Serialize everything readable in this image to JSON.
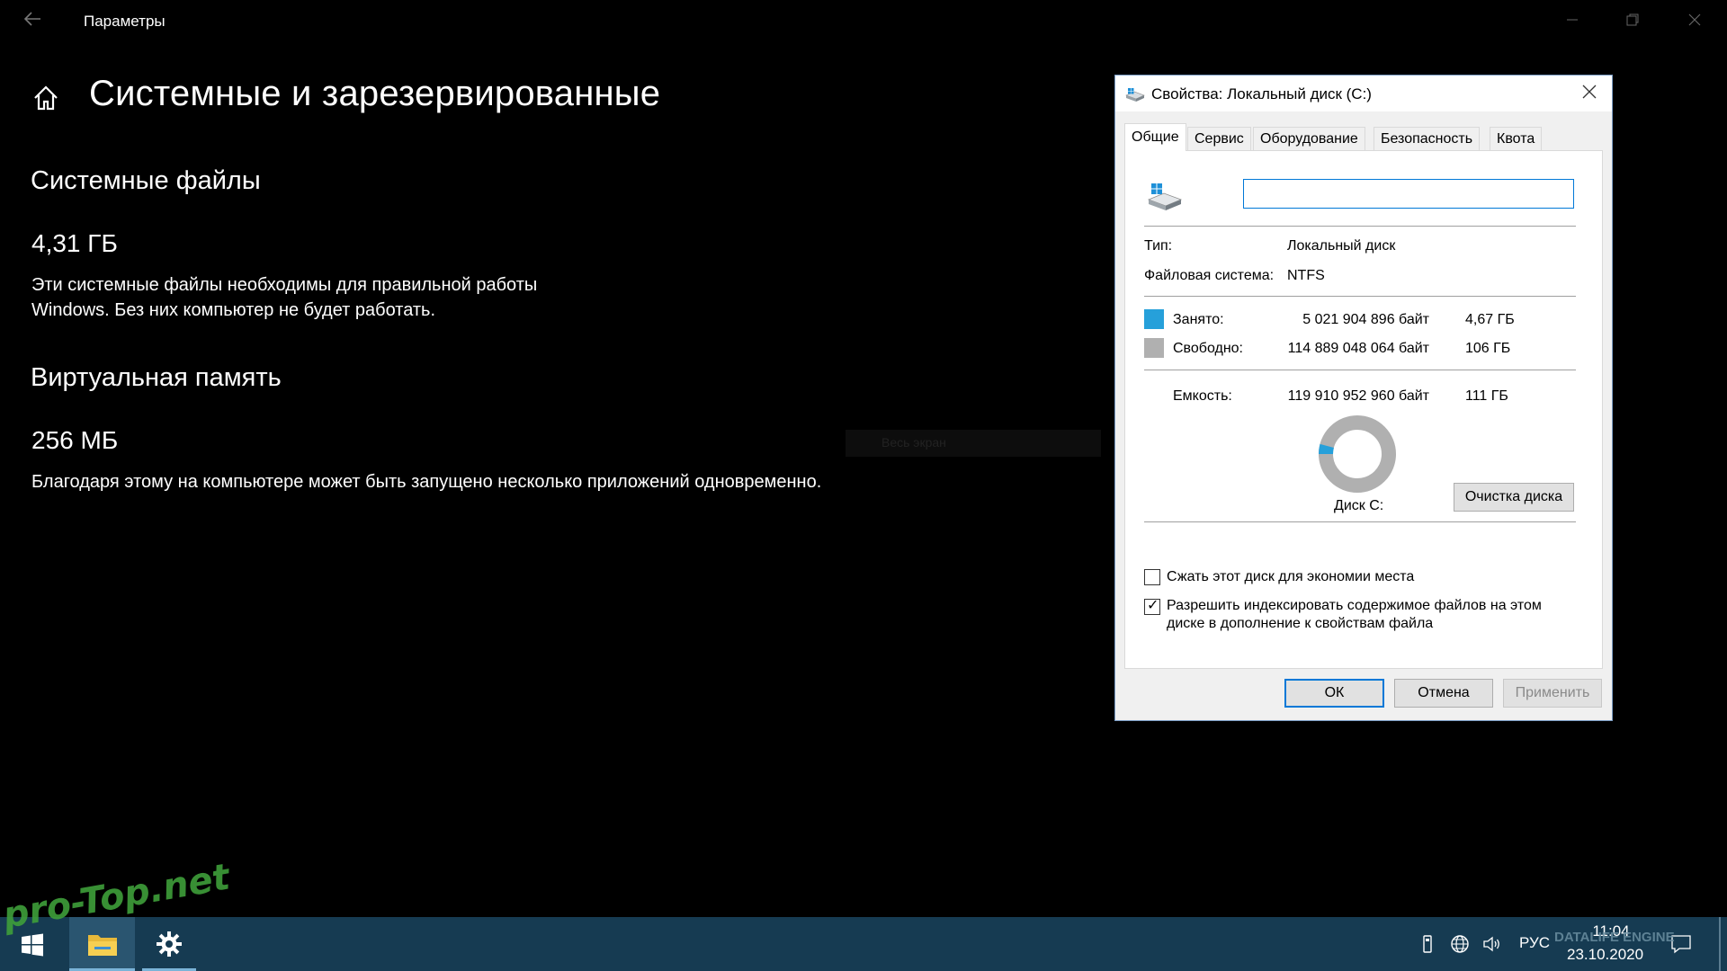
{
  "window": {
    "app_title": "Параметры"
  },
  "page": {
    "title": "Системные и зарезервированные",
    "system_files": {
      "heading": "Системные файлы",
      "size": "4,31 ГБ",
      "desc_line1": "Эти системные файлы необходимы для правильной работы",
      "desc_line2": "Windows. Без них компьютер не будет работать."
    },
    "virtual_memory": {
      "heading": "Виртуальная память",
      "size": "256 МБ",
      "desc": "Благодаря этому на компьютере может быть запущено несколько приложений одновременно."
    },
    "ghost_text": "Весь экран"
  },
  "dialog": {
    "title": "Свойства: Локальный диск (C:)",
    "tabs": [
      "Общие",
      "Сервис",
      "Оборудование",
      "Безопасность",
      "Квота"
    ],
    "name_value": "",
    "type_label": "Тип:",
    "type_value": "Локальный диск",
    "fs_label": "Файловая система:",
    "fs_value": "NTFS",
    "used_label": "Занято:",
    "used_bytes": "5 021 904 896 байт",
    "used_size": "4,67 ГБ",
    "free_label": "Свободно:",
    "free_bytes": "114 889 048 064 байт",
    "free_size": "106 ГБ",
    "capacity_label": "Емкость:",
    "capacity_bytes": "119 910 952 960 байт",
    "capacity_size": "111 ГБ",
    "used_fraction": 0.042,
    "used_color": "#26a0da",
    "free_color": "#b0b0b0",
    "disk_label": "Диск C:",
    "cleanup_button": "Очистка диска",
    "compress_label": "Сжать этот диск для экономии места",
    "compress_checked": false,
    "index_label_line1": "Разрешить индексировать содержимое файлов на этом",
    "index_label_line2": "диске в дополнение к свойствам файла",
    "index_checked": true,
    "ok_button": "ОК",
    "cancel_button": "Отмена",
    "apply_button": "Применить"
  },
  "taskbar": {
    "language": "РУС",
    "time": "11:04",
    "date": "23.10.2020"
  },
  "watermarks": {
    "left": "pro-Top.net",
    "right": "DATALIFE ENGINE"
  }
}
